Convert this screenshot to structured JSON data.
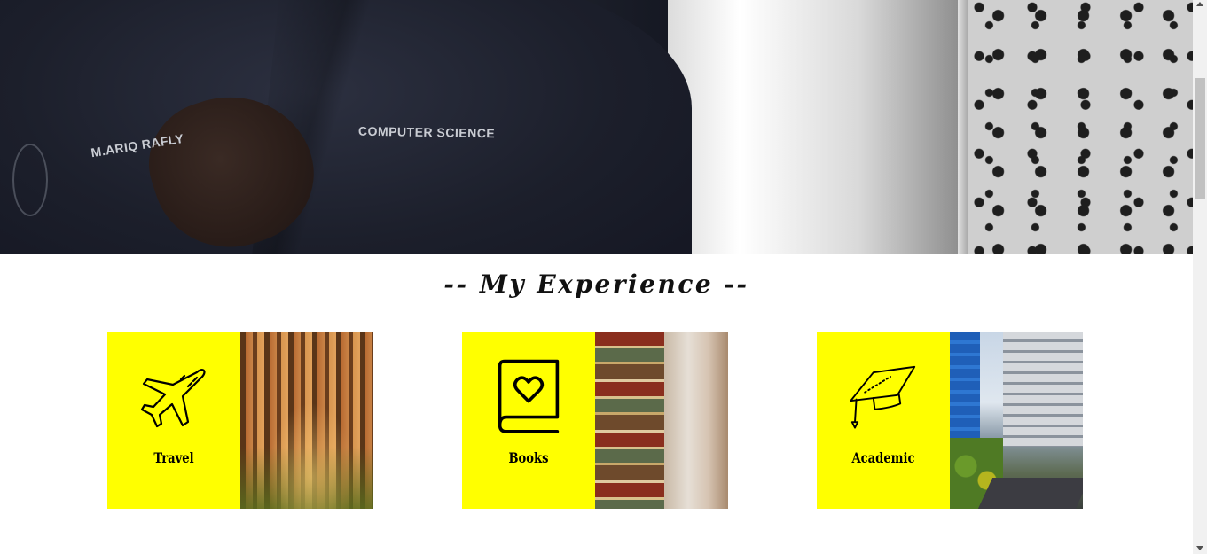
{
  "hero": {
    "patch_text_left": "M.ARIQ RAFLY",
    "patch_text_right": "COMPUTER SCIENCE"
  },
  "experience": {
    "title": "-- My Experience --",
    "cards": [
      {
        "label": "Travel",
        "icon": "airplane-icon",
        "photo": "forest"
      },
      {
        "label": "Books",
        "icon": "book-heart-icon",
        "photo": "book-stack"
      },
      {
        "label": "Academic",
        "icon": "graduation-cap-icon",
        "photo": "campus-building"
      }
    ]
  },
  "colors": {
    "card_panel": "#ffff00",
    "title_text": "#111111",
    "background": "#ffffff"
  }
}
